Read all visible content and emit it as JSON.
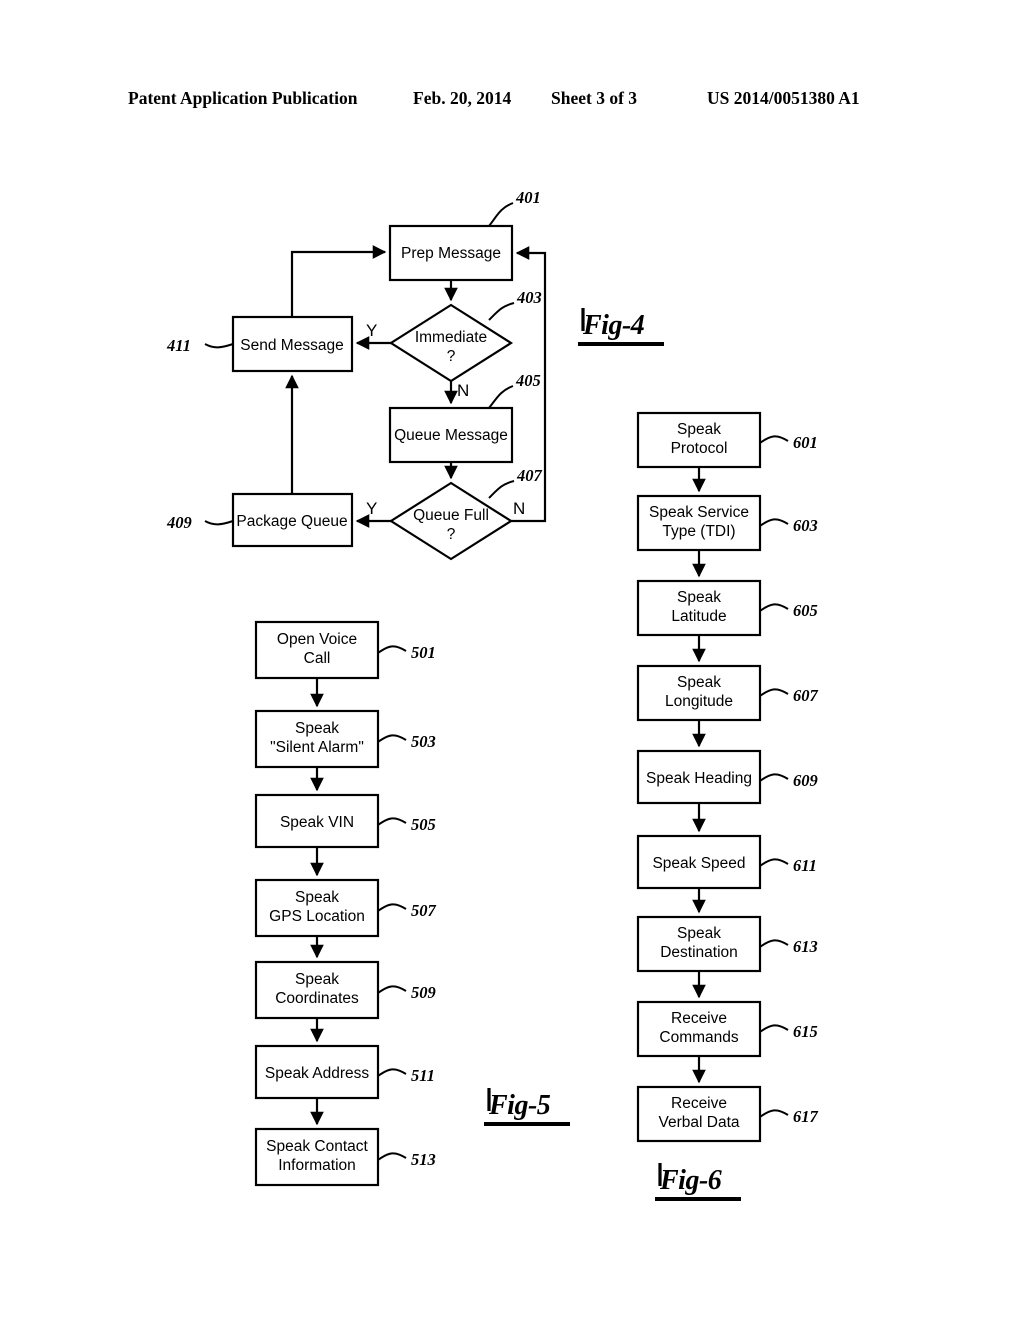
{
  "header": {
    "publication": "Patent Application Publication",
    "date": "Feb. 20, 2014",
    "sheet": "Sheet 3 of 3",
    "patent_number": "US 2014/0051380 A1"
  },
  "figures": [
    {
      "id": "fig4",
      "label": "Fig-4",
      "type": "flowchart",
      "nodes": [
        {
          "ref": "401",
          "shape": "rect",
          "text": [
            "Prep Message"
          ]
        },
        {
          "ref": "403",
          "shape": "diamond",
          "text": [
            "Immediate",
            "?"
          ]
        },
        {
          "ref": "405",
          "shape": "rect",
          "text": [
            "Queue Message"
          ]
        },
        {
          "ref": "407",
          "shape": "diamond",
          "text": [
            "Queue Full",
            "?"
          ]
        },
        {
          "ref": "409",
          "shape": "rect",
          "text": [
            "Package Queue"
          ]
        },
        {
          "ref": "411",
          "shape": "rect",
          "text": [
            "Send Message"
          ]
        }
      ],
      "branch_labels": {
        "immediate_yes": "Y",
        "immediate_no": "N",
        "queuefull_yes": "Y",
        "queuefull_no": "N"
      }
    },
    {
      "id": "fig5",
      "label": "Fig-5",
      "type": "flowchart",
      "nodes": [
        {
          "ref": "501",
          "shape": "rect",
          "text": [
            "Open Voice",
            "Call"
          ]
        },
        {
          "ref": "503",
          "shape": "rect",
          "text": [
            "Speak",
            "\"Silent Alarm\""
          ]
        },
        {
          "ref": "505",
          "shape": "rect",
          "text": [
            "Speak VIN"
          ]
        },
        {
          "ref": "507",
          "shape": "rect",
          "text": [
            "Speak",
            "GPS Location"
          ]
        },
        {
          "ref": "509",
          "shape": "rect",
          "text": [
            "Speak",
            "Coordinates"
          ]
        },
        {
          "ref": "511",
          "shape": "rect",
          "text": [
            "Speak Address"
          ]
        },
        {
          "ref": "513",
          "shape": "rect",
          "text": [
            "Speak Contact",
            "Information"
          ]
        }
      ]
    },
    {
      "id": "fig6",
      "label": "Fig-6",
      "type": "flowchart",
      "nodes": [
        {
          "ref": "601",
          "shape": "rect",
          "text": [
            "Speak",
            "Protocol"
          ]
        },
        {
          "ref": "603",
          "shape": "rect",
          "text": [
            "Speak Service",
            "Type (TDI)"
          ]
        },
        {
          "ref": "605",
          "shape": "rect",
          "text": [
            "Speak",
            "Latitude"
          ]
        },
        {
          "ref": "607",
          "shape": "rect",
          "text": [
            "Speak",
            "Longitude"
          ]
        },
        {
          "ref": "609",
          "shape": "rect",
          "text": [
            "Speak Heading"
          ]
        },
        {
          "ref": "611",
          "shape": "rect",
          "text": [
            "Speak Speed"
          ]
        },
        {
          "ref": "613",
          "shape": "rect",
          "text": [
            "Speak",
            "Destination"
          ]
        },
        {
          "ref": "615",
          "shape": "rect",
          "text": [
            "Receive",
            "Commands"
          ]
        },
        {
          "ref": "617",
          "shape": "rect",
          "text": [
            "Receive",
            "Verbal Data"
          ]
        }
      ]
    }
  ]
}
